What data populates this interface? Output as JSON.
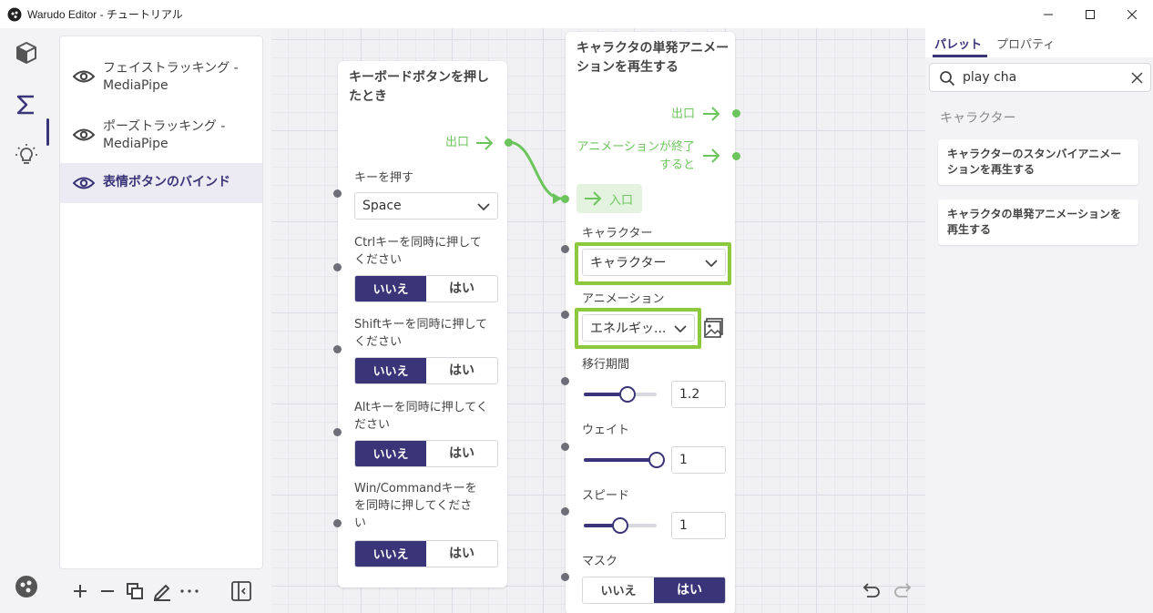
{
  "window": {
    "title": "Warudo Editor - チュートリアル"
  },
  "left_panel": {
    "items": [
      {
        "label": "フェイストラッキング - MediaPipe"
      },
      {
        "label": "ポーズトラッキング - MediaPipe"
      },
      {
        "label": "表情ボタンのバインド",
        "selected": true
      }
    ]
  },
  "node_keyboard": {
    "title": "キーボードボタンを押したとき",
    "exit_label": "出口",
    "key_label": "キーを押す",
    "key_value": "Space",
    "ctrl_label": "Ctrlキーを同時に押してください",
    "shift_label": "Shiftキーを同時に押してください",
    "alt_label": "Altキーを同時に押してください",
    "win_label": "Win/Commandキーをを同時に押してください",
    "no_label": "いいえ",
    "yes_label": "はい"
  },
  "node_anim": {
    "title": "キャラクタの単発アニメーションを再生する",
    "exit_label": "出口",
    "anim_end_label": "アニメーションが終了すると",
    "entry_label": "入口",
    "character_label": "キャラクター",
    "character_value": "キャラクター",
    "animation_label": "アニメーション",
    "animation_value": "エネルギッ...",
    "transition_label": "移行期間",
    "transition_value": "1.2",
    "transition_level": 0.6,
    "weight_label": "ウェイト",
    "weight_value": "1",
    "weight_level": 1.0,
    "speed_label": "スピード",
    "speed_value": "1",
    "speed_level": 0.5,
    "mask_label": "マスク",
    "no_label": "いいえ",
    "yes_label": "はい"
  },
  "right_panel": {
    "tabs": [
      "パレット",
      "プロパティ"
    ],
    "search_value": "play cha",
    "category": "キャラクター",
    "results": [
      "キャラクターのスタンバイアニメーションを再生する",
      "キャラクタの単発アニメーションを再生する"
    ]
  },
  "colors": {
    "accent": "#3a3478",
    "flow": "#6cc45c",
    "highlight": "#8cc93c"
  }
}
